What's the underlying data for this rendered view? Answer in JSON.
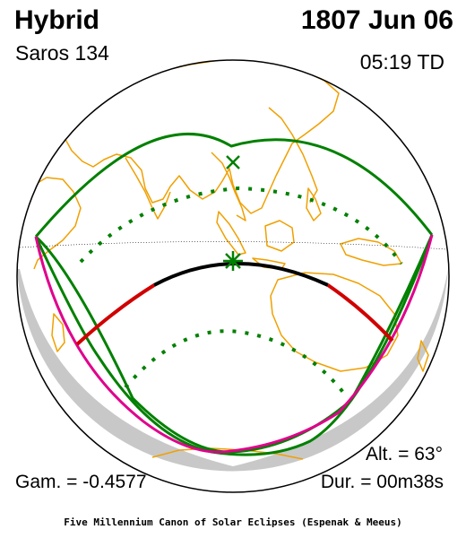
{
  "header": {
    "eclipse_type": "Hybrid",
    "date": "1807 Jun 06",
    "saros": "Saros 134",
    "time": "05:19 TD"
  },
  "stats": {
    "altitude": "Alt. = 63°",
    "gamma": "Gam. = -0.4577",
    "duration": "Dur. = 00m38s"
  },
  "credit": "Five Millennium Canon of Solar Eclipses (Espenak & Meeus)",
  "colors": {
    "land_outline": "#f0a000",
    "penumbral_limits": "#008000",
    "rise_set_curve": "#e0008c",
    "central_path_annular": "#d00000",
    "central_path_total": "#000000",
    "night_shading": "#c8c8c8"
  },
  "markers": {
    "greatest_eclipse": "asterisk",
    "subsolar_point": "x-cross"
  }
}
